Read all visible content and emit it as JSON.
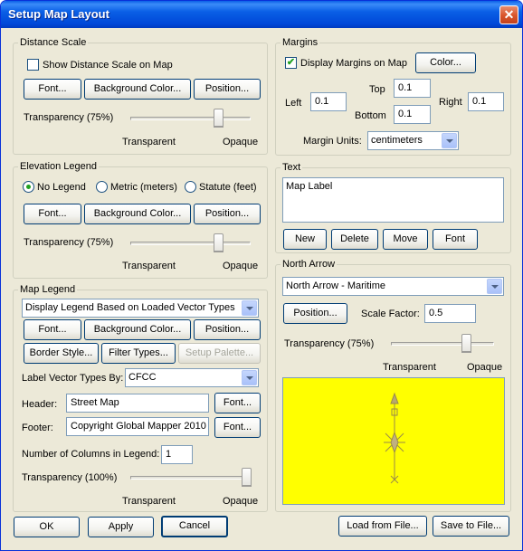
{
  "window": {
    "title": "Setup Map Layout",
    "close_symbol": "✕"
  },
  "distance_scale": {
    "legend": "Distance Scale",
    "show_label": "Show Distance Scale on Map",
    "show_checked": false,
    "font_btn": "Font...",
    "bg_color_btn": "Background Color...",
    "position_btn": "Position...",
    "transparency_label": "Transparency (75%)",
    "transparency_value": 75,
    "min_label": "Transparent",
    "max_label": "Opaque"
  },
  "elevation_legend": {
    "legend": "Elevation Legend",
    "options": [
      "No Legend",
      "Metric (meters)",
      "Statute (feet)"
    ],
    "selected": 0,
    "font_btn": "Font...",
    "bg_color_btn": "Background Color...",
    "position_btn": "Position...",
    "transparency_label": "Transparency (75%)",
    "transparency_value": 75,
    "min_label": "Transparent",
    "max_label": "Opaque"
  },
  "map_legend": {
    "legend": "Map Legend",
    "mode_select": "Display Legend Based on Loaded Vector Types",
    "font_btn": "Font...",
    "bg_color_btn": "Background Color...",
    "position_btn": "Position...",
    "border_style_btn": "Border Style...",
    "filter_types_btn": "Filter Types...",
    "setup_palette_btn": "Setup Palette...",
    "label_by_label": "Label Vector Types By:",
    "label_by_value": "CFCC",
    "header_label": "Header:",
    "header_value": "Street Map",
    "header_font_btn": "Font...",
    "footer_label": "Footer:",
    "footer_value": "Copyright Global Mapper 2010",
    "footer_font_btn": "Font...",
    "columns_label": "Number of Columns in Legend:",
    "columns_value": "1",
    "transparency_label": "Transparency (100%)",
    "transparency_value": 100,
    "min_label": "Transparent",
    "max_label": "Opaque"
  },
  "margins": {
    "legend": "Margins",
    "display_label": "Display Margins on Map",
    "display_checked": true,
    "color_btn": "Color...",
    "left_label": "Left",
    "left_value": "0.1",
    "top_label": "Top",
    "top_value": "0.1",
    "bottom_label": "Bottom",
    "bottom_value": "0.1",
    "right_label": "Right",
    "right_value": "0.1",
    "units_label": "Margin Units:",
    "units_value": "centimeters"
  },
  "text": {
    "legend": "Text",
    "items": [
      "Map Label"
    ],
    "new_btn": "New",
    "delete_btn": "Delete",
    "move_btn": "Move",
    "font_btn": "Font"
  },
  "north_arrow": {
    "legend": "North Arrow",
    "style_select": "North Arrow - Maritime",
    "position_btn": "Position...",
    "scale_label": "Scale Factor:",
    "scale_value": "0.5",
    "transparency_label": "Transparency (75%)",
    "transparency_value": 75,
    "min_label": "Transparent",
    "max_label": "Opaque",
    "preview_bg": "#ffff00"
  },
  "footer_buttons": {
    "ok": "OK",
    "apply": "Apply",
    "cancel": "Cancel",
    "load": "Load from File...",
    "save": "Save to File..."
  }
}
